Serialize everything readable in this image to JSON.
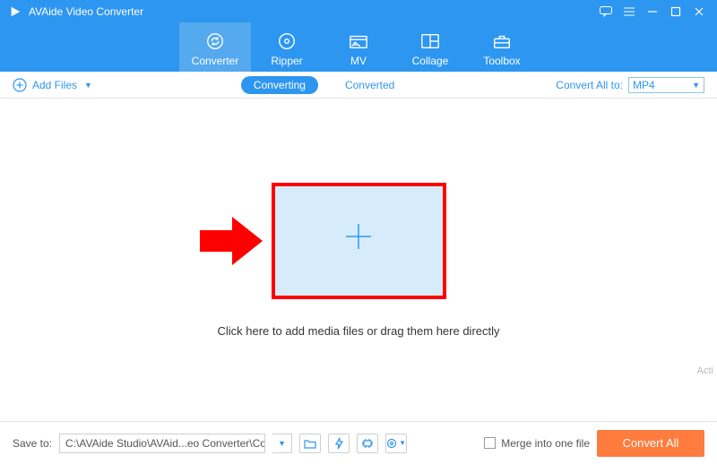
{
  "title": "AVAide Video Converter",
  "nav": {
    "items": [
      {
        "label": "Converter",
        "active": true
      },
      {
        "label": "Ripper",
        "active": false
      },
      {
        "label": "MV",
        "active": false
      },
      {
        "label": "Collage",
        "active": false
      },
      {
        "label": "Toolbox",
        "active": false
      }
    ]
  },
  "subbar": {
    "add_files": "Add Files",
    "converting": "Converting",
    "converted": "Converted",
    "convert_all_to_label": "Convert All to:",
    "format_selected": "MP4"
  },
  "main": {
    "drop_text": "Click here to add media files or drag them here directly"
  },
  "footer": {
    "save_to_label": "Save to:",
    "save_path": "C:\\AVAide Studio\\AVAid...eo Converter\\Converted",
    "merge_label": "Merge into one file",
    "convert_all": "Convert All"
  },
  "watermark": "Acti"
}
